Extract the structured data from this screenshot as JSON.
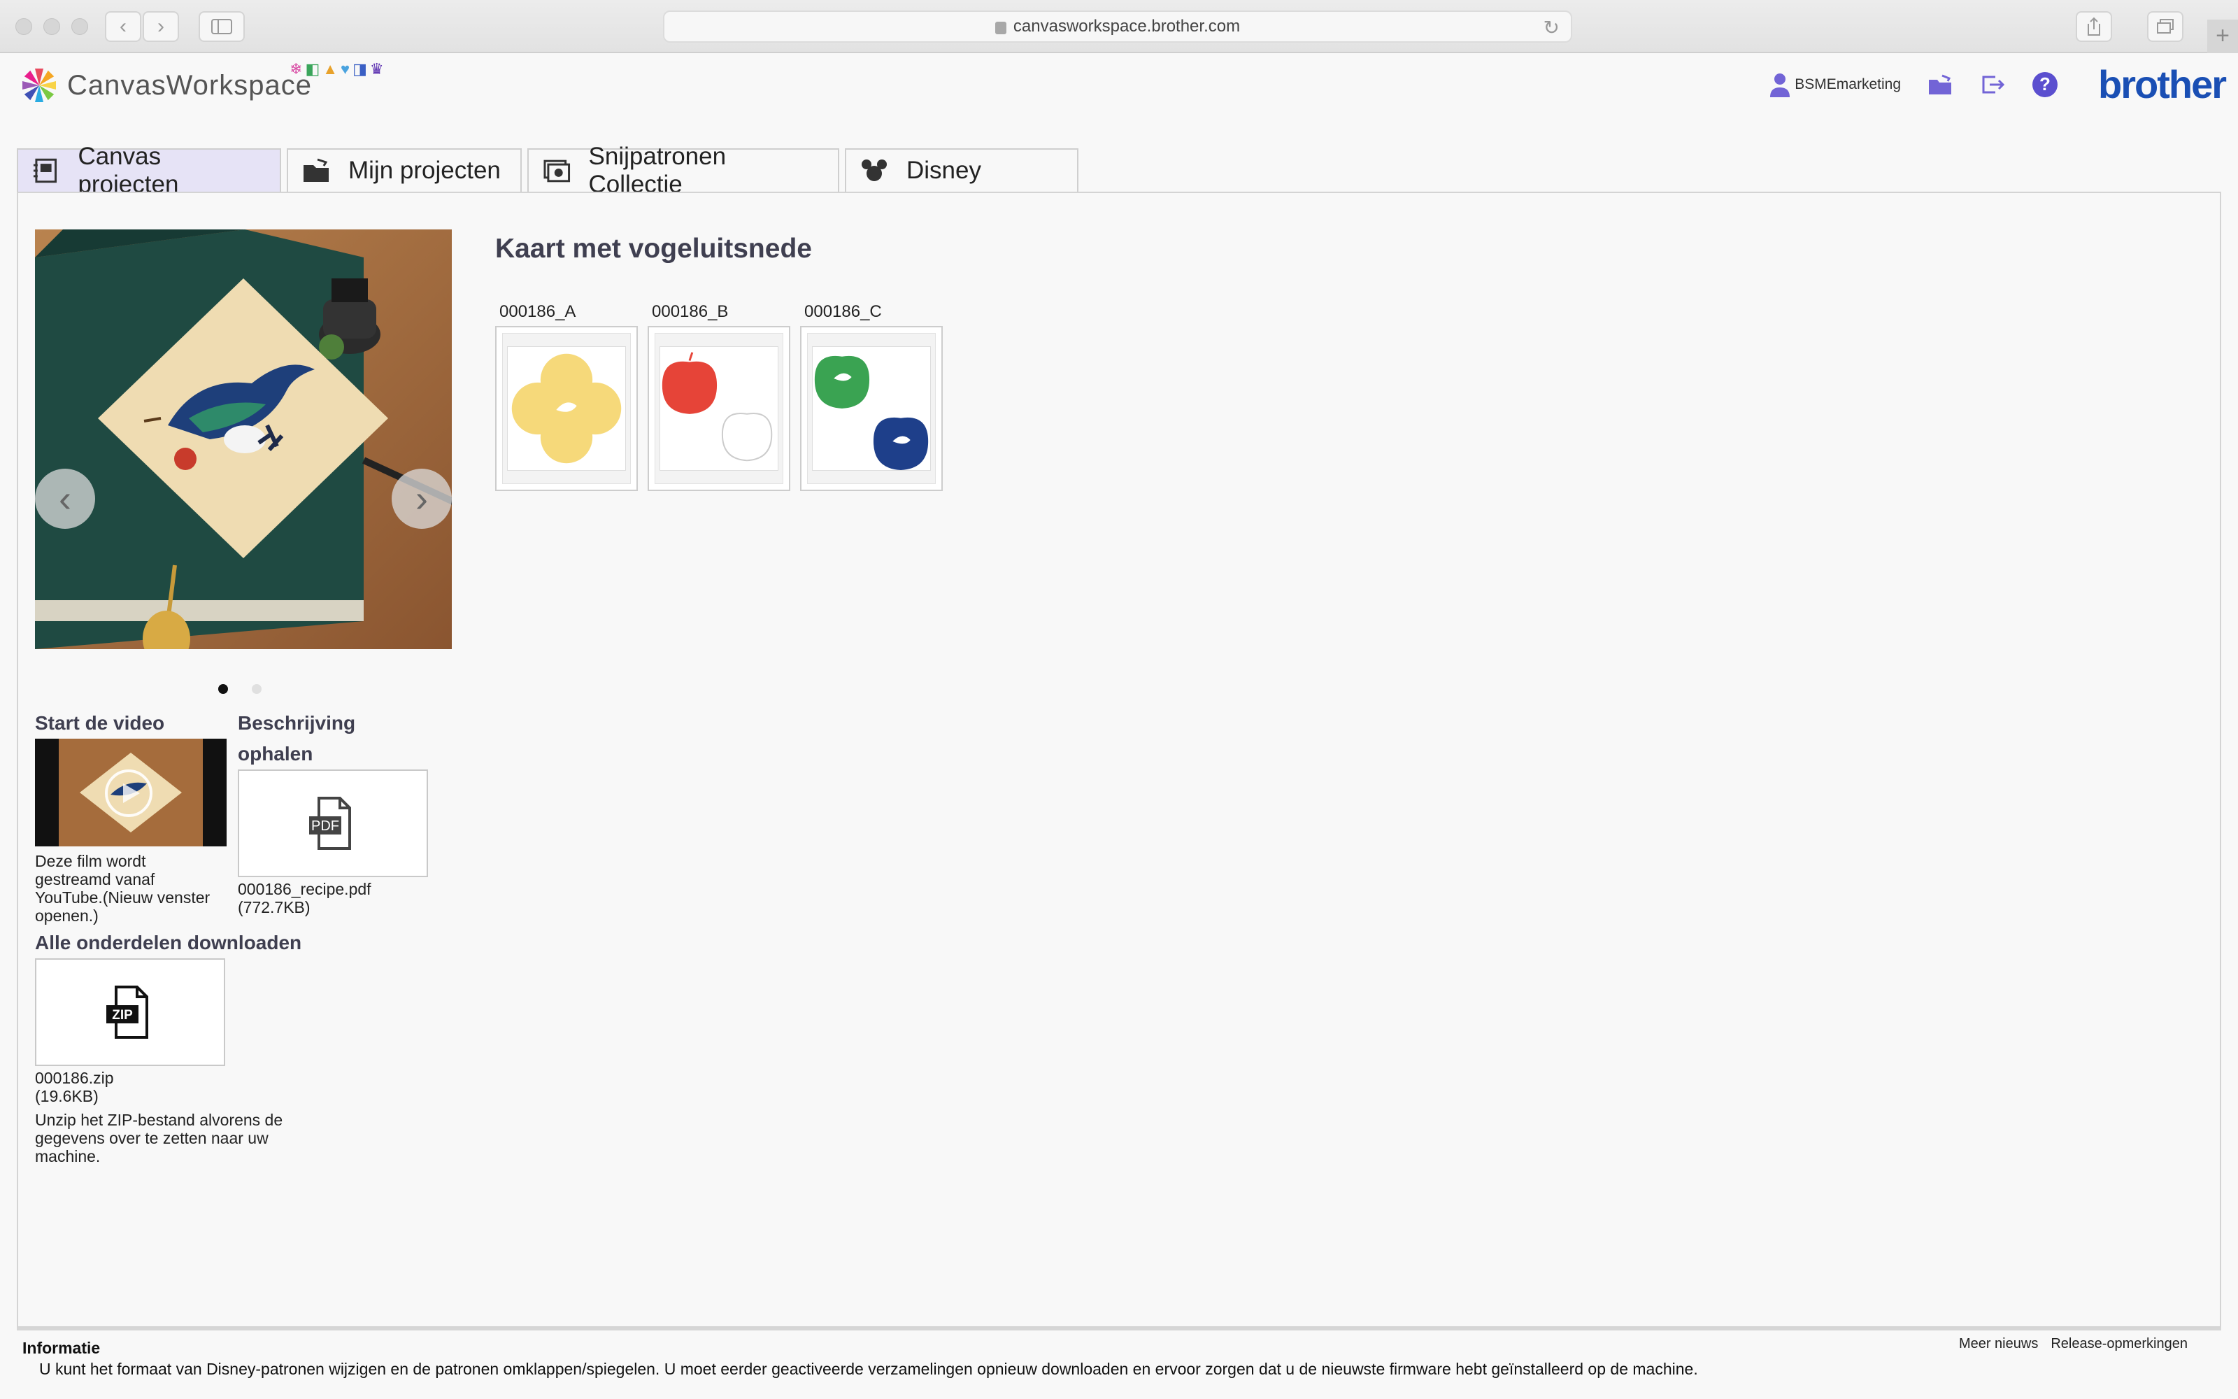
{
  "browser": {
    "url": "canvasworkspace.brother.com"
  },
  "header": {
    "logo_text": "CanvasWorkspace",
    "username": "BSMEmarketing",
    "brand": "brother",
    "help_label": "?"
  },
  "tabs": [
    {
      "label": "Canvas projecten",
      "icon": "canvas-projects-icon",
      "active": true
    },
    {
      "label": "Mijn projecten",
      "icon": "my-projects-icon",
      "active": false
    },
    {
      "label": "Snijpatronen Collectie",
      "icon": "cut-patterns-icon",
      "active": false
    },
    {
      "label": "Disney",
      "icon": "disney-icon",
      "active": false
    }
  ],
  "project": {
    "title": "Kaart met vogeluitsnede",
    "patterns": [
      {
        "label": "000186_A"
      },
      {
        "label": "000186_B"
      },
      {
        "label": "000186_C"
      }
    ]
  },
  "video": {
    "heading": "Start de video",
    "note": "Deze film wordt gestreamd vanaf YouTube.(Nieuw venster openen.)"
  },
  "description": {
    "heading": "Beschrijving ophalen",
    "icon_label": "PDF",
    "filename": "000186_recipe.pdf",
    "size": "(772.7KB)"
  },
  "download": {
    "heading": "Alle onderdelen downloaden",
    "icon_label": "ZIP",
    "filename": "000186.zip",
    "size": "(19.6KB)",
    "note": "Unzip het ZIP-bestand alvorens de gegevens over te zetten naar uw machine."
  },
  "info": {
    "heading": "Informatie",
    "text": "U kunt het formaat van Disney-patronen wijzigen en de patronen omklappen/spiegelen. U moet eerder geactiveerde verzamelingen opnieuw downloaden en ervoor zorgen dat u de nieuwste firmware hebt geïnstalleerd op de machine.",
    "more_news": "Meer nieuws",
    "release_notes": "Release-opmerkingen"
  },
  "colors": {
    "accent": "#5b4fcf",
    "brand": "#1a4fb4",
    "active_tab": "#e6e3f6"
  }
}
